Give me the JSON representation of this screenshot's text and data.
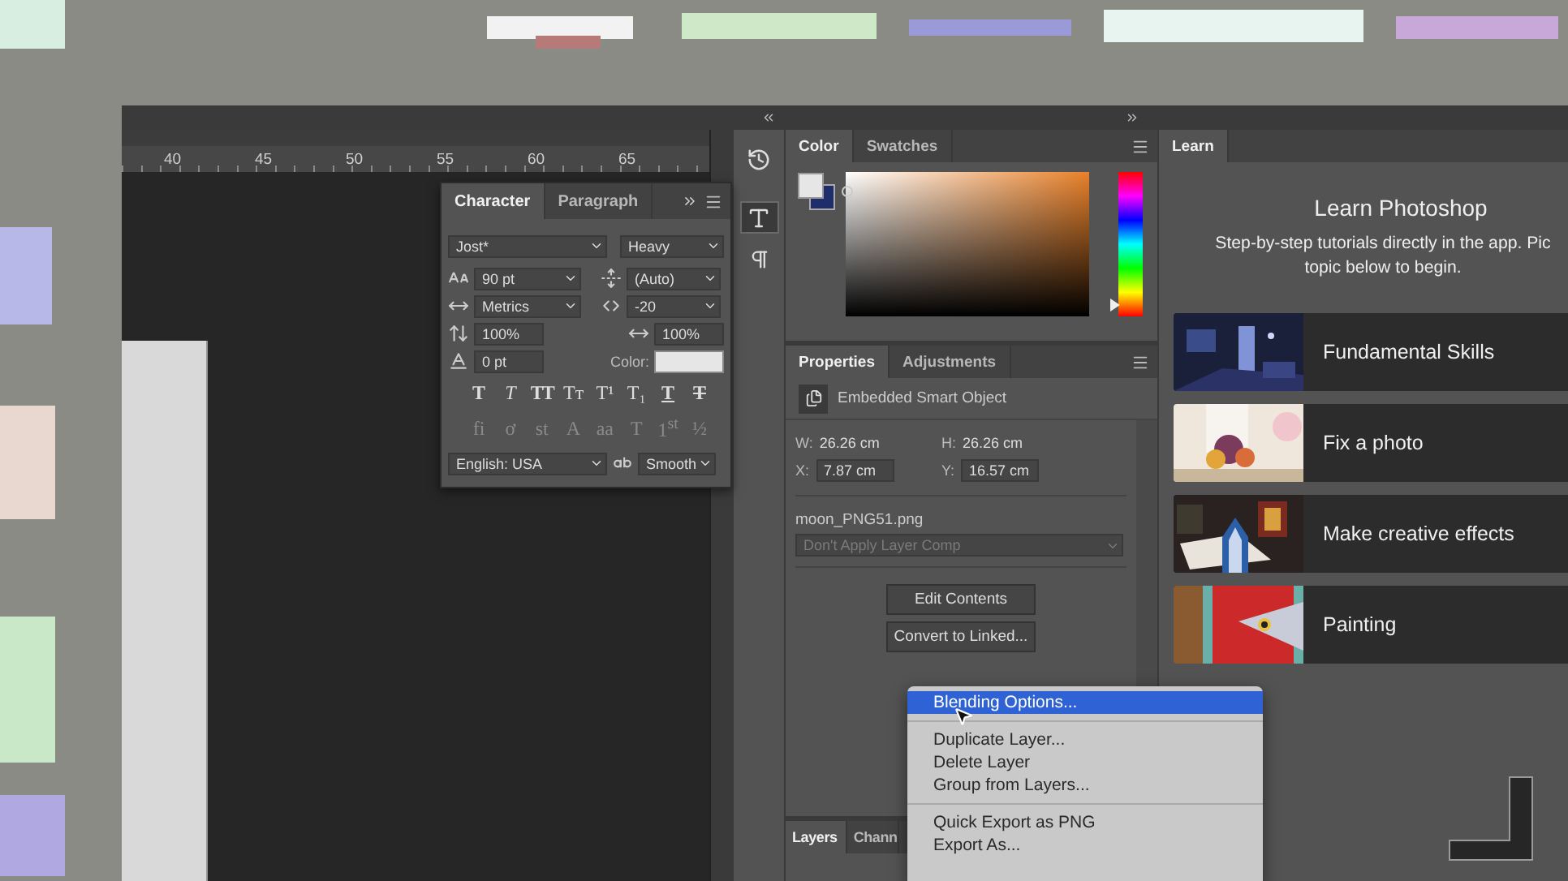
{
  "ruler_labels": [
    "40",
    "45",
    "50",
    "55",
    "60",
    "65"
  ],
  "character_panel": {
    "tabs": [
      {
        "label": "Character",
        "selected": true
      },
      {
        "label": "Paragraph",
        "selected": false
      }
    ],
    "font_family": "Jost*",
    "font_style": "Heavy",
    "size": "90 pt",
    "leading": "(Auto)",
    "kerning": "Metrics",
    "tracking": "-20",
    "vertical_scale": "100%",
    "horizontal_scale": "100%",
    "baseline_shift": "0 pt",
    "color_label": "Color:",
    "style_buttons": [
      {
        "kind": "faux-bold",
        "label": "T"
      },
      {
        "kind": "faux-italic",
        "label": "T"
      },
      {
        "kind": "all-caps",
        "label": "TT"
      },
      {
        "kind": "small-caps",
        "label": "Tт"
      },
      {
        "kind": "superscript",
        "label": "T¹"
      },
      {
        "kind": "subscript",
        "label": "T₁"
      },
      {
        "kind": "underline",
        "label": "T"
      },
      {
        "kind": "strikethrough",
        "label": "T"
      }
    ],
    "opentype_buttons": [
      {
        "label": "fi",
        "disabled": true
      },
      {
        "label": "ơ",
        "disabled": true
      },
      {
        "label": "st",
        "disabled": true
      },
      {
        "label": "A",
        "disabled": true
      },
      {
        "label": "aa",
        "disabled": true
      },
      {
        "label": "T",
        "disabled": true
      },
      {
        "label": "1$^{st}$",
        "disabled": true
      },
      {
        "label": "½",
        "disabled": true
      }
    ],
    "language": "English: USA",
    "antialias": "Smooth"
  },
  "side_tools": [
    {
      "kind": "history",
      "selected": false
    },
    {
      "kind": "character",
      "selected": true
    },
    {
      "kind": "paragraph",
      "selected": false
    }
  ],
  "color_panel": {
    "tabs": [
      {
        "label": "Color",
        "selected": true
      },
      {
        "label": "Swatches",
        "selected": false
      }
    ],
    "hue_slider": {
      "level": 0.08
    }
  },
  "properties_panel": {
    "tabs": [
      {
        "label": "Properties",
        "selected": true
      },
      {
        "label": "Adjustments",
        "selected": false
      }
    ],
    "object_type": "Embedded Smart Object",
    "w_label": "W:",
    "w_value": "26.26 cm",
    "h_label": "H:",
    "h_value": "26.26 cm",
    "x_label": "X:",
    "x_value": "7.87 cm",
    "y_label": "Y:",
    "y_value": "16.57 cm",
    "file_name": "moon_PNG51.png",
    "layer_comp": {
      "value": "Don't Apply Layer Comp",
      "disabled": true
    },
    "buttons": [
      "Edit Contents",
      "Convert to Linked..."
    ]
  },
  "layers_panel": {
    "tabs": [
      {
        "label": "Layers",
        "selected": true
      },
      {
        "label": "Chann",
        "selected": false
      }
    ]
  },
  "learn_panel": {
    "tabs": [
      {
        "label": "Learn",
        "selected": true
      }
    ],
    "title": "Learn Photoshop",
    "description": "Step-by-step tutorials directly in the app. Pic\ntopic below to begin.",
    "topics": [
      {
        "label": "Fundamental Skills",
        "kind": "picture"
      },
      {
        "label": "Fix a photo",
        "kind": "picture"
      },
      {
        "label": "Make creative effects",
        "kind": "picture"
      },
      {
        "label": "Painting",
        "kind": "picture"
      }
    ]
  },
  "context_menu": {
    "groups": [
      [
        {
          "label": "Blending Options...",
          "selected": true
        }
      ],
      [
        {
          "label": "Duplicate Layer...",
          "selected": false
        },
        {
          "label": "Delete Layer",
          "selected": false
        },
        {
          "label": "Group from Layers...",
          "selected": false
        }
      ],
      [
        {
          "label": "Quick Export as PNG",
          "selected": false
        },
        {
          "label": "Export As...",
          "selected": false
        }
      ]
    ]
  }
}
